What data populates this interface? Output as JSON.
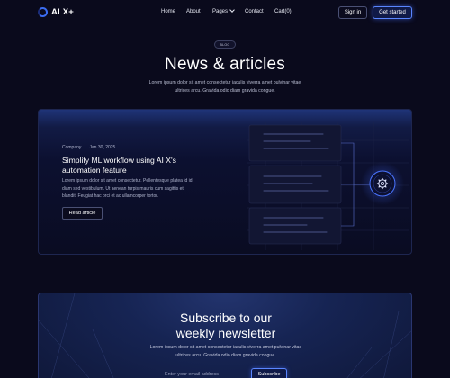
{
  "brand": {
    "name": "AI X+",
    "logo_icon": "ring-logo-icon"
  },
  "nav": {
    "items": [
      "Home",
      "About",
      "Pages",
      "Contact",
      "Cart(0)"
    ],
    "signin": "Sign in",
    "get_started": "Get started"
  },
  "hero": {
    "badge": "BLOG",
    "title": "News & articles",
    "subtitle": "Lorem ipsum dolor sit amet consectetur iaculis viverra amet pulvinar vitae ultrices arcu. Gravida odio diam gravida congue."
  },
  "featured": {
    "category": "Company",
    "date": "Jan 30, 2025",
    "title": "Simplify ML workflow using AI X's automation feature",
    "description": "Lorem ipsum dolor sit amet consectetur. Pellentesque platea id id diam sed vestibulum. Ut aenean turpis mauris cum sagittis et blandit. Feugiat hac orci et ac ullamcorper tortor.",
    "button": "Read article",
    "illustration_icon": "gear-icon"
  },
  "newsletter": {
    "title_line1": "Subscribe to our",
    "title_line2": "weekly newsletter",
    "subtitle": "Lorem ipsum dolor sit amet consectetur iaculis viverra amet pulvinar vitae ultrices arcu. Gravida odio diam gravida congue.",
    "email_placeholder": "Enter your email address",
    "button": "Subscribe"
  },
  "colors": {
    "background": "#0a0a1c",
    "accent": "#3b6cf0"
  }
}
